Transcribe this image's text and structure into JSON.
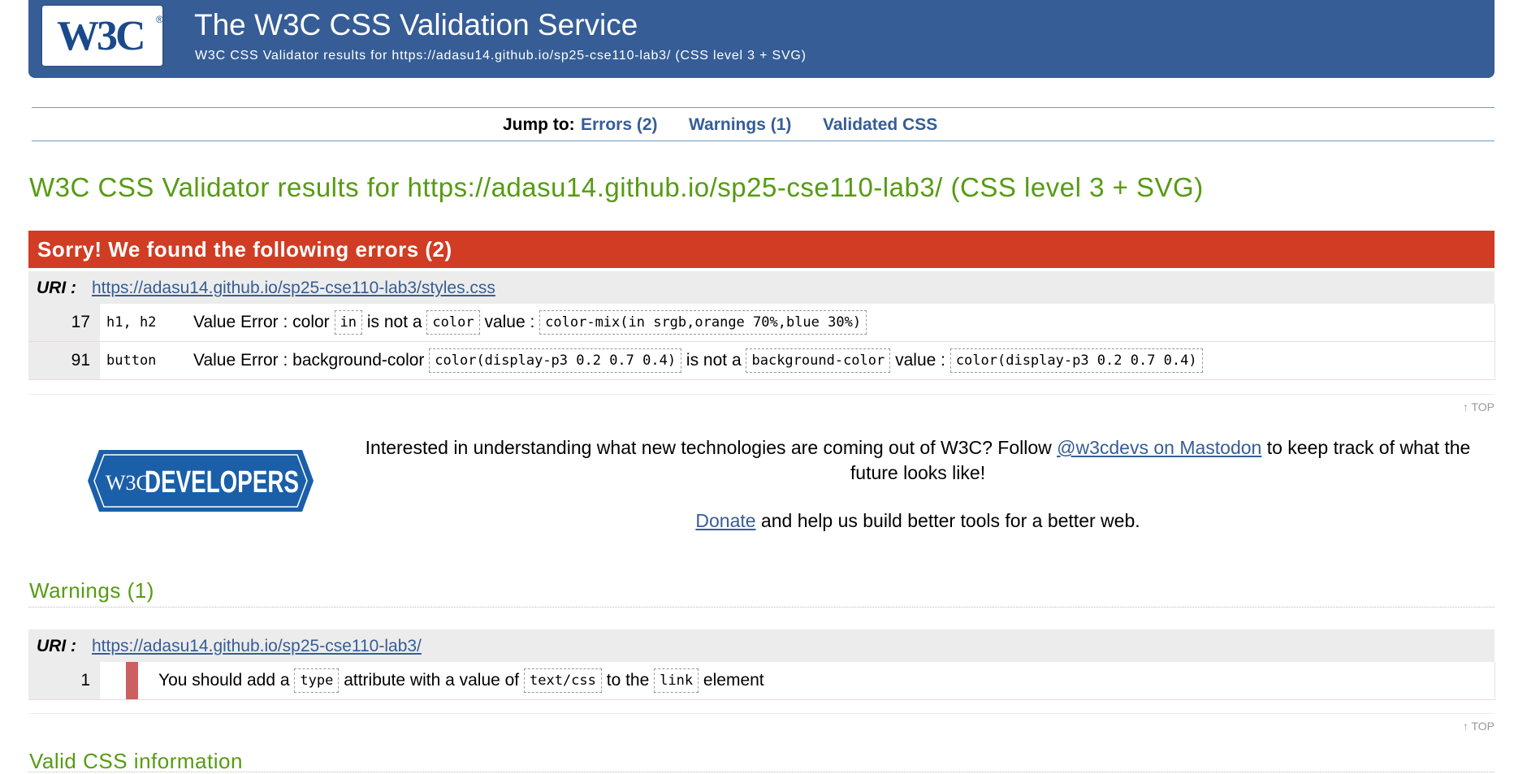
{
  "header": {
    "logo_text": "W3C",
    "logo_mark": "®",
    "title": "The W3C CSS Validation Service",
    "subtitle": "W3C CSS Validator results for https://adasu14.github.io/sp25-cse110-lab3/ (CSS level 3 + SVG)"
  },
  "jumpbar": {
    "label": "Jump to:",
    "links": [
      "Errors (2)",
      "Warnings (1)",
      "Validated CSS"
    ]
  },
  "results_heading": "W3C CSS Validator results for https://adasu14.github.io/sp25-cse110-lab3/ (CSS level 3 + SVG)",
  "errors": {
    "banner": "Sorry! We found the following errors (2)",
    "uri_label": "URI :",
    "uri": "https://adasu14.github.io/sp25-cse110-lab3/styles.css",
    "rows": [
      {
        "line": "17",
        "selector": "h1, h2",
        "prefix": "Value Error : color",
        "code1": "in",
        "mid": "is not a",
        "code2": "color",
        "mid2": "value :",
        "code3": "color-mix(in srgb,orange 70%,blue 30%)"
      },
      {
        "line": "91",
        "selector": "button",
        "prefix": "Value Error : background-color",
        "code1": "color(display-p3 0.2 0.7 0.4)",
        "mid": "is not a",
        "code2": "background-color",
        "mid2": "value :",
        "code3": "color(display-p3 0.2 0.7 0.4)"
      }
    ]
  },
  "top_link": "↑ TOP",
  "promo": {
    "dev_logo_w3c": "W3C",
    "dev_logo_word": "DEVELOPERS",
    "text_before": "Interested in understanding what new technologies are coming out of W3C? Follow ",
    "link": "@w3cdevs on Mastodon",
    "text_after": " to keep track of what the future looks like!",
    "donate_link": "Donate",
    "donate_text": " and help us build better tools for a better web."
  },
  "warnings": {
    "heading": "Warnings (1)",
    "uri_label": "URI :",
    "uri": "https://adasu14.github.io/sp25-cse110-lab3/",
    "rows": [
      {
        "line": "1",
        "t1": "You should add a",
        "code1": "type",
        "t2": "attribute with a value of",
        "code2": "text/css",
        "t3": "to the",
        "code3": "link",
        "t4": "element"
      }
    ]
  },
  "valid_heading": "Valid CSS information",
  "colors": {
    "header_blue": "#365d95",
    "heading_green": "#569b12",
    "error_red": "#d13c24",
    "warning_marker": "#cc6060"
  }
}
